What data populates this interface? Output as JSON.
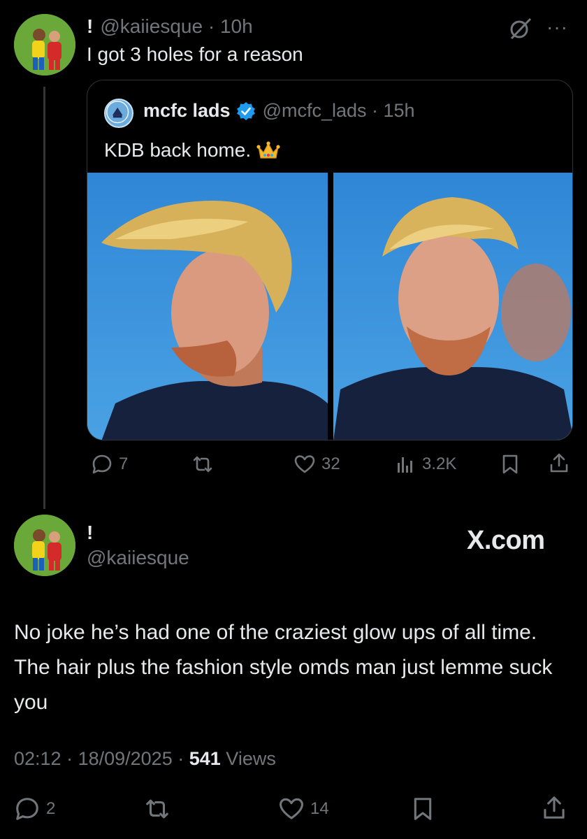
{
  "tweet1": {
    "display_name": "!",
    "handle": "@kaiiesque",
    "time": "10h",
    "text": "I got 3 holes for a reason"
  },
  "quote": {
    "display_name": "mcfc lads",
    "handle": "@mcfc_lads",
    "time": "15h",
    "text": "KDB back home.",
    "emoji": "crown-emoji",
    "verified": true
  },
  "tweet1_actions": {
    "replies": "7",
    "reposts": "",
    "likes": "32",
    "views": "3.2K"
  },
  "tweet2": {
    "display_name": "!",
    "handle": "@kaiiesque",
    "watermark": "X.com",
    "body": "No joke he’s had one of the craziest glow ups of all time. The hair plus the fashion style omds man just lemme suck you",
    "time": "02:12",
    "date": "18/09/2025",
    "views_count": "541",
    "views_label": "Views"
  },
  "tweet2_actions": {
    "replies": "2",
    "reposts": "",
    "likes": "14"
  },
  "colors": {
    "background": "#000000",
    "text_primary": "#e7e9ea",
    "text_secondary": "#71767b",
    "border": "#2f3336",
    "verified": "#1d9bf0"
  }
}
